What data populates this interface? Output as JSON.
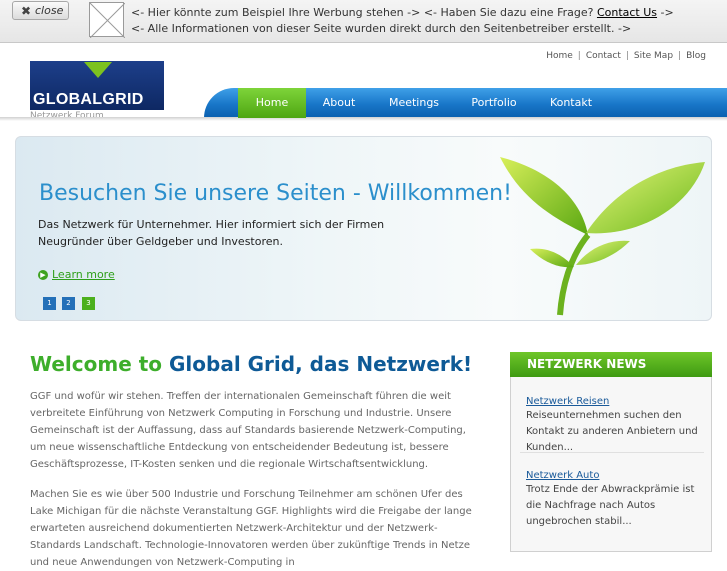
{
  "ad": {
    "close_label": "close",
    "line1_prefix": "<- Hier könnte zum Beispiel Ihre Werbung stehen -> <- Haben Sie dazu eine Frage?",
    "contact_link": "Contact Us",
    "line1_suffix": "->",
    "line2": "<- Alle Informationen von dieser Seite wurden direkt durch den Seitenbetreiber erstellt. ->"
  },
  "logo": {
    "name": "GLOBALGRID",
    "subtitle": "Netzwerk Forum"
  },
  "top_links": [
    "Home",
    "Contact",
    "Site Map",
    "Blog"
  ],
  "nav": {
    "items": [
      "Home",
      "About",
      "Meetings",
      "Portfolio",
      "Kontakt"
    ],
    "active": "Home",
    "accent": "#5bb51e",
    "bar_color": "#1876c8"
  },
  "hero": {
    "title": "Besuchen Sie unsere Seiten - Willkommen!",
    "text": "Das Netzwerk für Unternehmer. Hier informiert sich der Firmen Neugründer über Geldgeber und Investoren.",
    "learn_more": "Learn more",
    "slides": [
      "1",
      "2",
      "3"
    ],
    "active_slide": "3"
  },
  "main": {
    "welcome_green": "Welcome to",
    "welcome_blue": "Global Grid, das Netzwerk!",
    "para1": "GGF und wofür wir stehen. Treffen der internationalen Gemeinschaft führen die weit verbreitete Einführung von Netzwerk Computing in Forschung und Industrie. Unsere Gemeinschaft ist der Auffassung, dass auf Standards basierende Netzwerk-Computing, um neue wissenschaftliche Entdeckung von entscheidender Bedeutung ist, bessere Geschäftsprozesse, IT-Kosten senken und die regionale Wirtschaftsentwicklung.",
    "para2": "Machen Sie es wie über 500 Industrie und Forschung Teilnehmer am schönen Ufer des Lake Michigan für die nächste Veranstaltung GGF. Highlights wird die Freigabe der lange erwarteten ausreichend dokumentierten Netzwerk-Architektur und der Netzwerk-Standards Landschaft. Technologie-Innovatoren werden über zukünftige Trends in Netze und neue Anwendungen von Netzwerk-Computing in"
  },
  "news": {
    "heading": "NETZWERK NEWS",
    "items": [
      {
        "title": "Netzwerk Reisen",
        "text": "Reiseunternehmen suchen den Kontakt zu anderen Anbietern und Kunden..."
      },
      {
        "title": "Netzwerk Auto",
        "text": "Trotz Ende der Abwrackprämie ist die Nachfrage nach Autos ungebrochen stabil..."
      }
    ]
  }
}
